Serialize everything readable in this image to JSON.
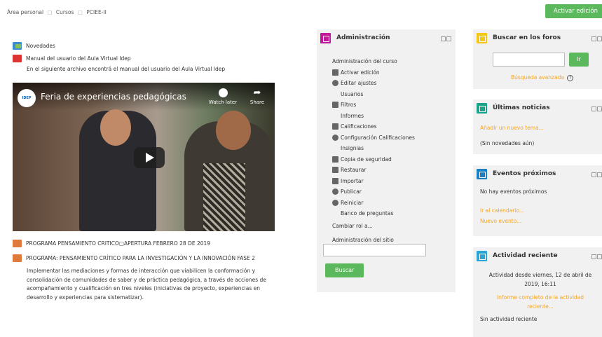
{
  "breadcrumb": {
    "home": "Área personal",
    "courses": "Cursos",
    "course": "PCIEE-II",
    "sep": "▢"
  },
  "header": {
    "edit_button": "Activar edición"
  },
  "main": {
    "news": "Novedades",
    "manual": "Manual del usuario del Aula Virtual Idep",
    "manual_desc": "En el siguiente archivo encontrá el manual  del usuario del  Aula Virtual Idep",
    "video": {
      "title": "Feria de experiencias pedagógicas",
      "logo": "IDEP",
      "watch_later": "Watch later",
      "share": "Share"
    },
    "program1": "PROGRAMA PENSAMIENTO CRITICO▢APERTURA FEBRERO 28 DE 2019",
    "program2": "PROGRAMA: PENSAMIENTO CRÍTICO PARA LA INVESTIGACIÓN Y LA INNOVACIÓN FASE 2",
    "paragraph": "Implementar  las mediaciones y formas de interacción que viabilicen la conformación y consolidación de comunidades de saber y de práctica pedagógica, a través de acciones de acompañamiento y cualificación en tres niveles (iniciativas de proyecto, experiencias en desarrollo y experiencias para sistematizar)."
  },
  "admin": {
    "title": "Administración",
    "icon_color": "#c0179b",
    "items": [
      "Administración del curso",
      "Activar edición",
      "Editar ajustes",
      "Usuarios",
      "Filtros",
      "Informes",
      "Calificaciones",
      "Configuración Calificaciones",
      "Insignias",
      "Copia de seguridad",
      "Restaurar",
      "Importar",
      "Publicar",
      "Reiniciar",
      "Banco de preguntas",
      "Cambiar rol a...",
      "Administración del sitio"
    ],
    "search_button": "Buscar"
  },
  "forums": {
    "title": "Buscar en los foros",
    "icon_color": "#f5c518",
    "go_button": "Ir",
    "advanced": "Búsqueda avanzada",
    "help": "?"
  },
  "news": {
    "title": "Últimas noticias",
    "icon_color": "#1aa38a",
    "add": "Añadir un nuevo tema...",
    "empty": "(Sin novedades aún)"
  },
  "events": {
    "title": "Eventos próximos",
    "icon_color": "#1b7fc4",
    "empty": "No hay eventos próximos",
    "calendar": "Ir al calendario...",
    "new": "Nuevo evento..."
  },
  "recent": {
    "title": "Actividad reciente",
    "icon_color": "#2aa5d8",
    "since": "Actividad desde viernes, 12 de abril de 2019, 16:11",
    "report": "Informe completo de la actividad reciente...",
    "empty": "Sin actividad reciente"
  },
  "colors": {
    "green": "#5cb85c",
    "link_orange": "#f5a623"
  }
}
